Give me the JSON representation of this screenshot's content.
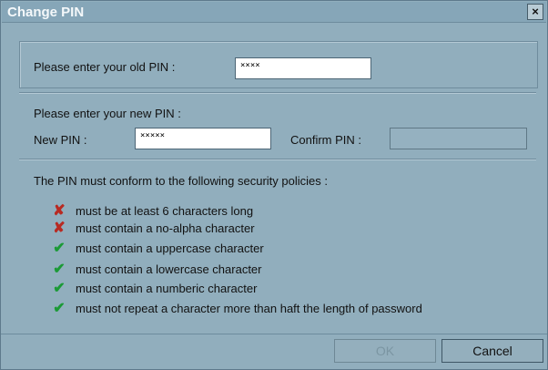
{
  "window": {
    "title": "Change PIN",
    "close_glyph": "×"
  },
  "old_pin": {
    "label": "Please enter your old PIN :",
    "value": "××××"
  },
  "new_pin_section": {
    "label": "Please enter your new PIN :",
    "new_label": "New PIN :",
    "new_value": "×××××",
    "confirm_label": "Confirm PIN :",
    "confirm_value": ""
  },
  "policies": {
    "heading": "The PIN must conform to the following security policies :",
    "items": [
      {
        "text": "must be at least 6 characters long",
        "status": "fail",
        "icon": "cross-icon"
      },
      {
        "text": "must contain a no-alpha character",
        "status": "fail",
        "icon": "cross-icon"
      },
      {
        "text": "must contain a uppercase character",
        "status": "pass",
        "icon": "check-icon"
      },
      {
        "text": "must contain a lowercase character",
        "status": "pass",
        "icon": "check-icon"
      },
      {
        "text": "must contain a numberic character",
        "status": "pass",
        "icon": "check-icon"
      },
      {
        "text": "must not repeat a character more than haft the length of password",
        "status": "pass",
        "icon": "check-icon"
      }
    ]
  },
  "buttons": {
    "ok": "OK",
    "cancel": "Cancel"
  },
  "colors": {
    "fail": "#b82a22",
    "pass": "#1b9a36"
  }
}
